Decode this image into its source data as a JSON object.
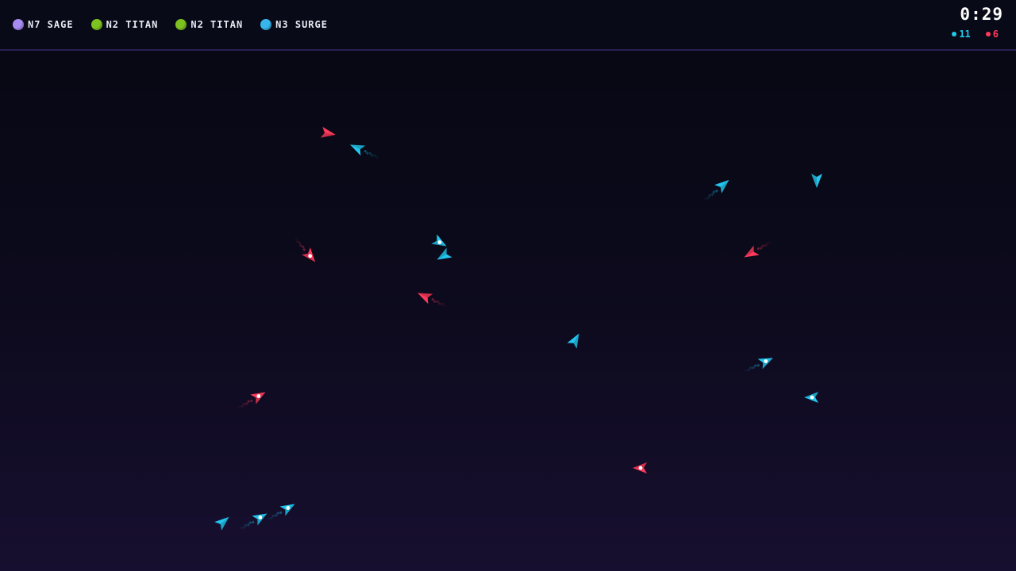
{
  "hud": {
    "squads": [
      {
        "label": "N7 SAGE",
        "color": "#a78bf0",
        "icon": "sage-orb-icon"
      },
      {
        "label": "N2 TITAN",
        "color": "#7ec21f",
        "icon": "titan-orb-icon"
      },
      {
        "label": "N2 TITAN",
        "color": "#7ec21f",
        "icon": "titan-orb-icon"
      },
      {
        "label": "N3 SURGE",
        "color": "#37b6ee",
        "icon": "surge-orb-icon"
      }
    ],
    "timer": "0:29",
    "counts": {
      "blue": {
        "value": "11",
        "color": "#22c8e8",
        "icon": "blue-team-dot-icon"
      },
      "red": {
        "value": "6",
        "color": "#ff3a5c",
        "icon": "red-team-dot-icon"
      }
    }
  },
  "colors": {
    "blue": "#22c6ee",
    "red": "#ff3a5c"
  }
}
